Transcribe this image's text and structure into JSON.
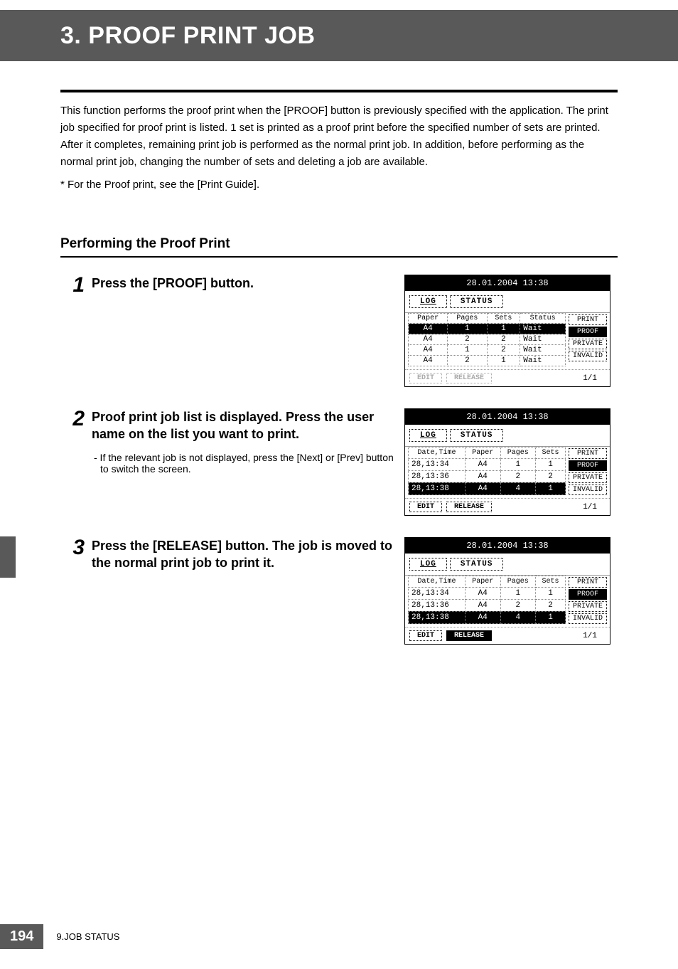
{
  "header": {
    "title": "3. PROOF PRINT JOB"
  },
  "intro": {
    "paragraph": "This function performs the proof print when the [PROOF] button is previously specified with the application. The print job specified for proof print is listed. 1 set is printed as a proof print before the specified number of sets are printed. After it completes, remaining print job is performed as the normal print job. In addition, before performing as the normal print job, changing the number of sets and deleting a job are available.",
    "footnote": "*  For the Proof print, see the [Print Guide]."
  },
  "section": {
    "title": "Performing the Proof Print"
  },
  "steps": [
    {
      "num": "1",
      "title": "Press the [PROOF] button."
    },
    {
      "num": "2",
      "title": "Proof print job list is displayed. Press the user name on the list you want to print.",
      "note": "-  If the relevant job is not displayed, press the [Next] or [Prev] button to switch the screen."
    },
    {
      "num": "3",
      "title": "Press the [RELEASE] button. The job is moved to the normal print job to print it."
    }
  ],
  "lcd_common": {
    "datetime": "28.01.2004 13:38",
    "tabs": {
      "log": "LOG",
      "status": "STATUS"
    },
    "side": {
      "print": "PRINT",
      "proof": "PROOF",
      "private": "PRIVATE",
      "invalid": "INVALID"
    },
    "bottom": {
      "edit": "EDIT",
      "release": "RELEASE",
      "page": "1/1"
    }
  },
  "lcd1": {
    "headers": {
      "paper": "Paper",
      "pages": "Pages",
      "sets": "Sets",
      "status": "Status"
    },
    "rows": [
      {
        "paper": "A4",
        "pages": "1",
        "sets": "1",
        "status": "Wait",
        "selected": true
      },
      {
        "paper": "A4",
        "pages": "2",
        "sets": "2",
        "status": "Wait"
      },
      {
        "paper": "A4",
        "pages": "1",
        "sets": "2",
        "status": "Wait"
      },
      {
        "paper": "A4",
        "pages": "2",
        "sets": "1",
        "status": "Wait"
      }
    ]
  },
  "lcd23": {
    "headers": {
      "datetime": "Date,Time",
      "paper": "Paper",
      "pages": "Pages",
      "sets": "Sets"
    },
    "rows": [
      {
        "datetime": "28,13:34",
        "paper": "A4",
        "pages": "1",
        "sets": "1"
      },
      {
        "datetime": "28,13:36",
        "paper": "A4",
        "pages": "2",
        "sets": "2"
      },
      {
        "datetime": "28,13:38",
        "paper": "A4",
        "pages": "4",
        "sets": "1",
        "selected": true
      }
    ]
  },
  "footer": {
    "page": "194",
    "chapter": "9.JOB STATUS"
  }
}
